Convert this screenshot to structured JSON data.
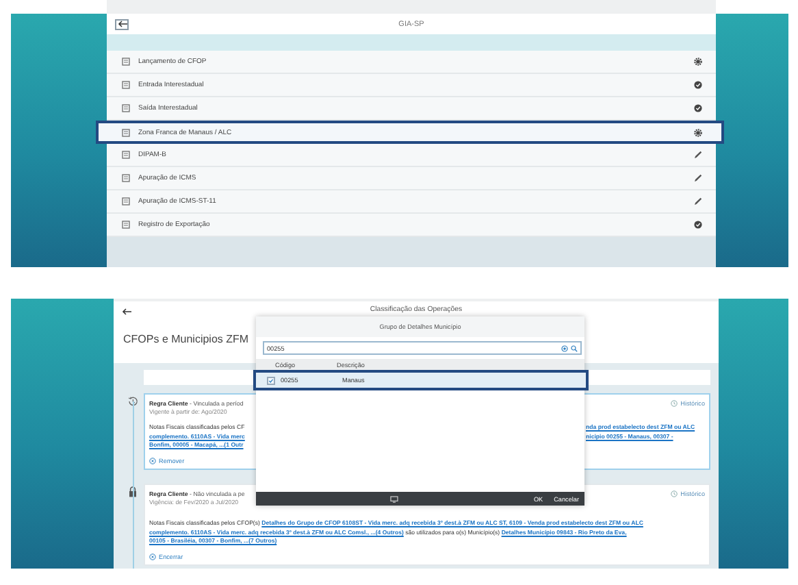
{
  "screen_1": {
    "title": "GIA-SP",
    "items": [
      {
        "label": "Lançamento de CFOP",
        "kind": "gear",
        "selected": false
      },
      {
        "label": "Entrada Interestadual",
        "kind": "check",
        "selected": false
      },
      {
        "label": "Saída Interestadual",
        "kind": "check",
        "selected": false
      },
      {
        "label": "Zona Franca de Manaus / ALC",
        "kind": "gear",
        "selected": true
      },
      {
        "label": "DIPAM-B",
        "kind": "pencil",
        "selected": false
      },
      {
        "label": "Apuração de ICMS",
        "kind": "pencil",
        "selected": false
      },
      {
        "label": "Apuração de ICMS-ST-11",
        "kind": "pencil",
        "selected": false
      },
      {
        "label": "Registro de Exportação",
        "kind": "check",
        "selected": false
      }
    ]
  },
  "screen_2": {
    "title": "Classificação das Operações",
    "heading": "CFOPs e Municipios ZFM",
    "rules": [
      {
        "kind": "history",
        "selected": true,
        "title": "Regra Cliente",
        "status": "- Vinculada a períod",
        "period": "Vigente à partir de: Ago/2020",
        "history": "Histórico",
        "lines": [
          {
            "left": "Notas Fiscais classificadas pelos CF",
            "left_link": false,
            "right": "nda prod estabelecto dest ZFM ou ALC",
            "right_link": true
          },
          {
            "left": "complemento. 6110AS - Vida merc",
            "left_link": true,
            "right": "nicipio 00255 - Manaus, 00307 -",
            "right_link": true
          },
          {
            "left": "Bonfim, 00005 - Macapá, ...(1 Outr",
            "left_link": true
          }
        ],
        "action": "Remover"
      },
      {
        "kind": "lock",
        "selected": false,
        "title": "Regra Cliente",
        "status": "- Não vinculada a pe",
        "period": "Vigência: de Fev/2020 a Jul/2020",
        "history": "Histórico",
        "text_lines": [
          [
            {
              "text": "Notas Fiscais classificadas pelos CFOP(s)",
              "link": false
            },
            {
              "text": "Detalhes do Grupo de CFOP 6108ST - Vida merc. adq recebida 3º dest.à ZFM ou ALC ST, 6109 - Venda prod estabelecto dest ZFM ou ALC",
              "link": true
            }
          ],
          [
            {
              "text": "complemento. 6110AS - Vida merc. adq recebida 3º dest.à ZFM ou ALC Comsl., ...(4 Outros)",
              "link": true
            },
            {
              "text": "são utilizados para o(s) Município(s)",
              "link": false
            },
            {
              "text": "Detalhes Município 09843 - Rio Preto da Eva,",
              "link": true
            }
          ],
          [
            {
              "text": "00105 - Brasiléia, 00307 - Bonfim, ...(7 Outros)",
              "link": true
            }
          ]
        ],
        "action": "Encerrar"
      }
    ],
    "dialog": {
      "title": "Grupo de Detalhes Município",
      "search": {
        "value": "00255"
      },
      "columns": [
        "Código",
        "Descrição"
      ],
      "rows": [
        {
          "code": "00255",
          "description": "Manaus",
          "checked": true,
          "selected": true
        }
      ],
      "buttons": [
        "OK",
        "Cancelar"
      ]
    }
  }
}
